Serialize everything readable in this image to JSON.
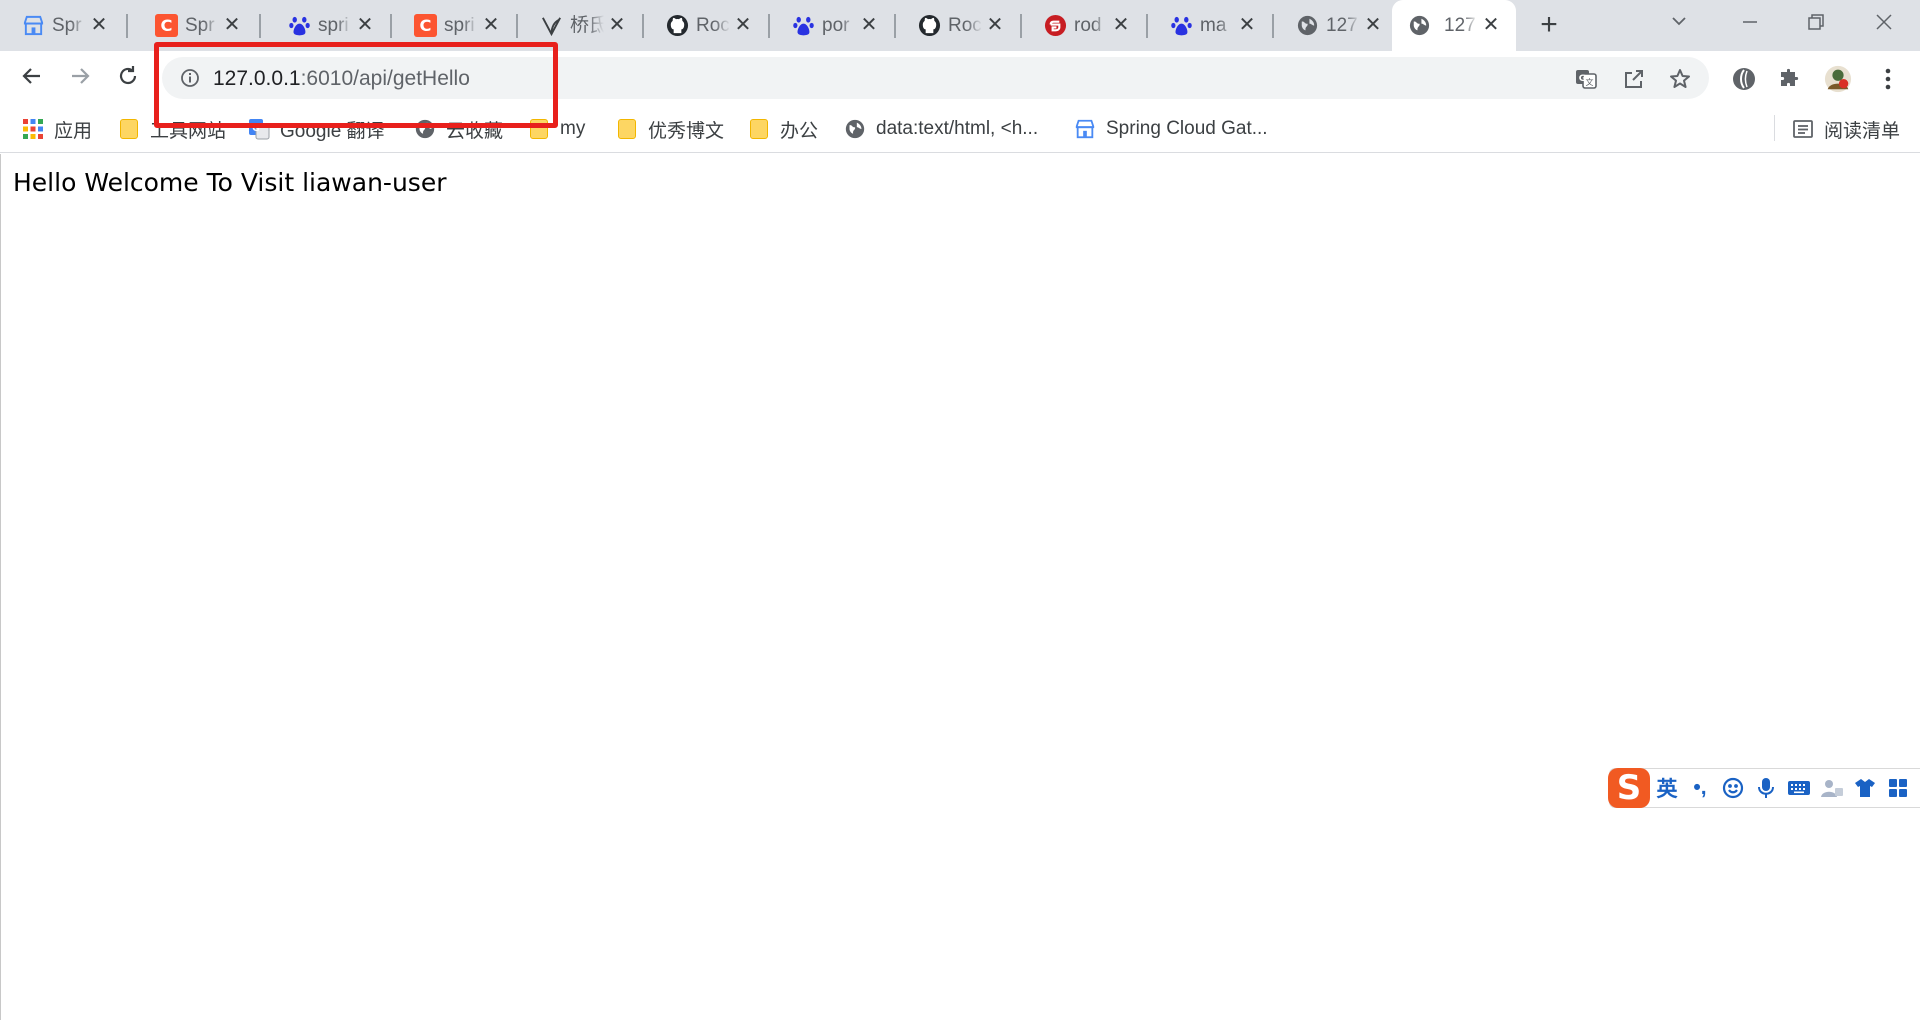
{
  "tabs": [
    {
      "title": "Spr",
      "icon": "storefront-icon"
    },
    {
      "title": "Spr",
      "icon": "csdn-icon"
    },
    {
      "title": "spri",
      "icon": "baidu-paw-icon"
    },
    {
      "title": "spri",
      "icon": "csdn-icon"
    },
    {
      "title": "桥氐",
      "icon": "shield-leaf-icon"
    },
    {
      "title": "Roc",
      "icon": "github-icon"
    },
    {
      "title": "por",
      "icon": "baidu-paw-icon"
    },
    {
      "title": "Roc",
      "icon": "github-icon"
    },
    {
      "title": "rod",
      "icon": "gitee-icon"
    },
    {
      "title": "ma",
      "icon": "baidu-paw-icon"
    },
    {
      "title": "127",
      "icon": "globe-icon"
    },
    {
      "title": "127",
      "icon": "globe-icon",
      "active": true
    }
  ],
  "address": {
    "host": "127.0.0.1",
    "path": ":6010/api/getHello"
  },
  "bookmarks": [
    {
      "label": "应用",
      "icon": "apps-grid-icon"
    },
    {
      "label": "工具网站",
      "icon": "folder-icon"
    },
    {
      "label": "Google 翻译",
      "icon": "google-translate-icon"
    },
    {
      "label": "云收藏",
      "icon": "globe-icon"
    },
    {
      "label": "my",
      "icon": "folder-icon"
    },
    {
      "label": "优秀博文",
      "icon": "folder-icon"
    },
    {
      "label": "办公",
      "icon": "folder-icon"
    },
    {
      "label": "data:text/html, <h...",
      "icon": "globe-icon"
    },
    {
      "label": "Spring Cloud Gat...",
      "icon": "storefront-icon"
    }
  ],
  "reading_list": {
    "label": "阅读清单"
  },
  "page": {
    "body_text": "Hello Welcome To Visit liawan-user"
  },
  "ime": {
    "logo": "S",
    "mode": "英",
    "punct": "•,"
  },
  "colors": {
    "tabstrip_bg": "#dee1e6",
    "omnibox_bg": "#f1f3f4",
    "highlight_red": "#e8201c",
    "csdn_red": "#fc5531",
    "baidu_blue": "#2932e1",
    "gitee_red": "#c71d23",
    "sogou_orange": "#f15a22"
  }
}
